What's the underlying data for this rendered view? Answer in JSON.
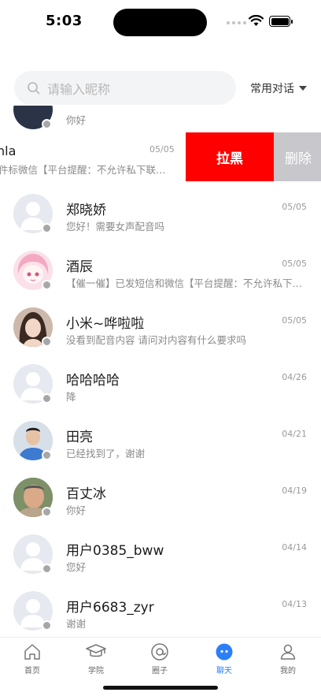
{
  "status_bar": {
    "time": "5:03"
  },
  "search": {
    "placeholder": "请输入昵称"
  },
  "filter": {
    "label": "常用对话"
  },
  "partial_row": {
    "message": "你好"
  },
  "swiped_row": {
    "name": "nla",
    "message": "件标微信【平台提醒：不允许私下联…",
    "date": "05/05",
    "block_label": "拉黑",
    "delete_label": "删除"
  },
  "conversations": [
    {
      "name": "郑晓娇",
      "message": "您好！需要女声配音吗",
      "date": "05/05",
      "avatar": "default-avatar"
    },
    {
      "name": "酒辰",
      "message": "【催一催】已发短信和微信【平台提醒：不允许私下交易】",
      "date": "05/05",
      "avatar": "anime-girl-avatar"
    },
    {
      "name": "小米~哗啦啦",
      "message": "没看到配音内容 请问对内容有什么要求吗",
      "date": "05/05",
      "avatar": "woman-photo-avatar"
    },
    {
      "name": "哈哈哈哈",
      "message": "降",
      "date": "04/26",
      "avatar": "default-avatar"
    },
    {
      "name": "田亮",
      "message": "已经找到了，谢谢",
      "date": "04/21",
      "avatar": "man-photo-avatar"
    },
    {
      "name": "百丈冰",
      "message": "你好",
      "date": "04/19",
      "avatar": "man-photo-avatar"
    },
    {
      "name": "用户0385_bww",
      "message": "您好",
      "date": "04/14",
      "avatar": "default-avatar"
    },
    {
      "name": "用户6683_zyr",
      "message": "谢谢",
      "date": "04/13",
      "avatar": "default-avatar"
    }
  ],
  "tabs": [
    {
      "label": "首页",
      "icon": "home-icon",
      "active": false
    },
    {
      "label": "学院",
      "icon": "graduation-cap-icon",
      "active": false
    },
    {
      "label": "圈子",
      "icon": "at-circle-icon",
      "active": false
    },
    {
      "label": "聊天",
      "icon": "chat-bubble-icon",
      "active": true
    },
    {
      "label": "我的",
      "icon": "person-icon",
      "active": false
    }
  ],
  "colors": {
    "accent": "#2b7ff7",
    "block": "#ff0000",
    "delete": "#c7c7cc",
    "presence": "#a7a7a7"
  }
}
